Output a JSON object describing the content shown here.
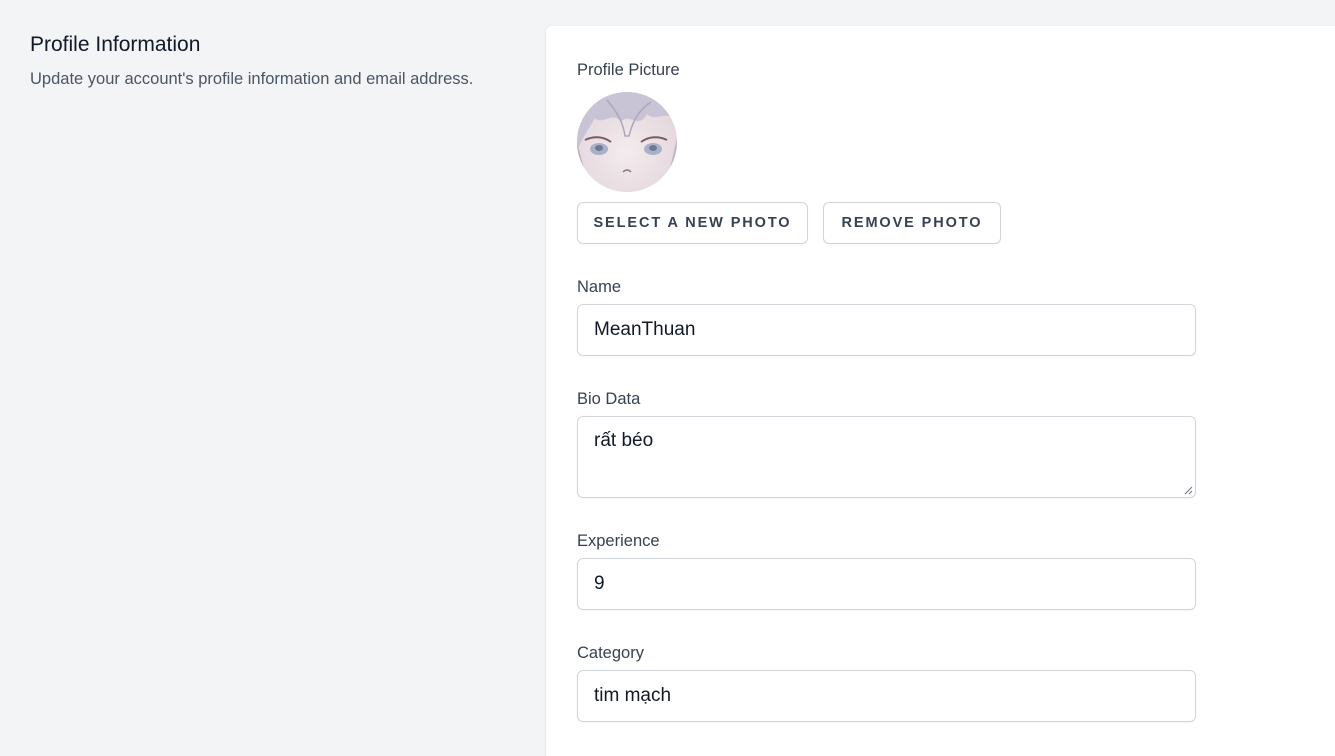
{
  "section": {
    "title": "Profile Information",
    "description": "Update your account's profile information and email address."
  },
  "profile_picture": {
    "label": "Profile Picture",
    "select_button": "Select a New Photo",
    "remove_button": "Remove Photo"
  },
  "fields": {
    "name": {
      "label": "Name",
      "value": "MeanThuan"
    },
    "bio": {
      "label": "Bio Data",
      "value": "rất béo"
    },
    "experience": {
      "label": "Experience",
      "value": "9"
    },
    "category": {
      "label": "Category",
      "value": "tim mạch"
    }
  },
  "colors": {
    "page_bg": "#f3f4f6",
    "card_bg": "#ffffff",
    "border": "#d1d5db",
    "text_primary": "#111827",
    "text_secondary": "#4b5563"
  }
}
